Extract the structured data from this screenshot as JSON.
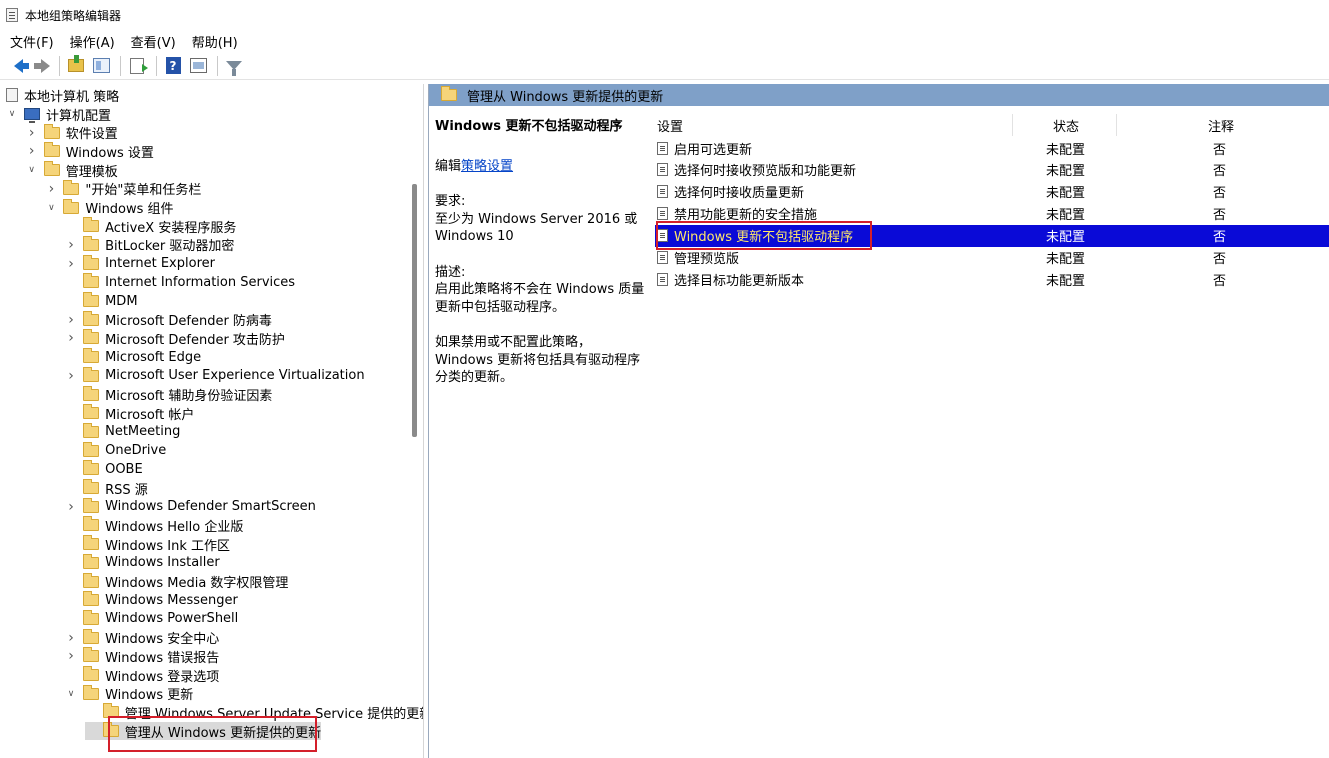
{
  "window": {
    "title": "本地组策略编辑器"
  },
  "menu": [
    "文件(F)",
    "操作(A)",
    "查看(V)",
    "帮助(H)"
  ],
  "toolbar": {
    "icons": [
      "back-arrow-icon",
      "forward-arrow-icon",
      "folder-up-icon",
      "show-hide-tree-icon",
      "export-list-icon",
      "help-icon",
      "properties-icon",
      "filter-icon"
    ],
    "help_glyph": "?"
  },
  "tree": {
    "items": [
      {
        "label": "本地计算机 策略",
        "level": 0,
        "icon": "policy-root-icon",
        "expander": ""
      },
      {
        "label": "计算机配置",
        "level": 0,
        "icon": "computer-icon",
        "expander": "expanded"
      },
      {
        "label": "软件设置",
        "level": 1,
        "icon": "folder-icon",
        "expander": "collapsed"
      },
      {
        "label": "Windows 设置",
        "level": 1,
        "icon": "folder-icon",
        "expander": "collapsed"
      },
      {
        "label": "管理模板",
        "level": 1,
        "icon": "folder-icon",
        "expander": "expanded"
      },
      {
        "label": "\"开始\"菜单和任务栏",
        "level": 2,
        "icon": "folder-icon",
        "expander": "collapsed"
      },
      {
        "label": "Windows 组件",
        "level": 2,
        "icon": "folder-icon",
        "expander": "expanded"
      },
      {
        "label": "ActiveX 安装程序服务",
        "level": 3,
        "icon": "folder-icon",
        "expander": ""
      },
      {
        "label": "BitLocker 驱动器加密",
        "level": 3,
        "icon": "folder-icon",
        "expander": "collapsed"
      },
      {
        "label": "Internet Explorer",
        "level": 3,
        "icon": "folder-icon",
        "expander": "collapsed"
      },
      {
        "label": "Internet Information Services",
        "level": 3,
        "icon": "folder-icon",
        "expander": ""
      },
      {
        "label": "MDM",
        "level": 3,
        "icon": "folder-icon",
        "expander": ""
      },
      {
        "label": "Microsoft Defender 防病毒",
        "level": 3,
        "icon": "folder-icon",
        "expander": "collapsed"
      },
      {
        "label": "Microsoft Defender 攻击防护",
        "level": 3,
        "icon": "folder-icon",
        "expander": "collapsed"
      },
      {
        "label": "Microsoft Edge",
        "level": 3,
        "icon": "folder-icon",
        "expander": ""
      },
      {
        "label": "Microsoft User Experience Virtualization",
        "level": 3,
        "icon": "folder-icon",
        "expander": "collapsed"
      },
      {
        "label": "Microsoft 辅助身份验证因素",
        "level": 3,
        "icon": "folder-icon",
        "expander": ""
      },
      {
        "label": "Microsoft 帐户",
        "level": 3,
        "icon": "folder-icon",
        "expander": ""
      },
      {
        "label": "NetMeeting",
        "level": 3,
        "icon": "folder-icon",
        "expander": ""
      },
      {
        "label": "OneDrive",
        "level": 3,
        "icon": "folder-icon",
        "expander": ""
      },
      {
        "label": "OOBE",
        "level": 3,
        "icon": "folder-icon",
        "expander": ""
      },
      {
        "label": "RSS 源",
        "level": 3,
        "icon": "folder-icon",
        "expander": ""
      },
      {
        "label": "Windows Defender SmartScreen",
        "level": 3,
        "icon": "folder-icon",
        "expander": "collapsed"
      },
      {
        "label": "Windows Hello 企业版",
        "level": 3,
        "icon": "folder-icon",
        "expander": ""
      },
      {
        "label": "Windows Ink 工作区",
        "level": 3,
        "icon": "folder-icon",
        "expander": ""
      },
      {
        "label": "Windows Installer",
        "level": 3,
        "icon": "folder-icon",
        "expander": ""
      },
      {
        "label": "Windows Media 数字权限管理",
        "level": 3,
        "icon": "folder-icon",
        "expander": ""
      },
      {
        "label": "Windows Messenger",
        "level": 3,
        "icon": "folder-icon",
        "expander": ""
      },
      {
        "label": "Windows PowerShell",
        "level": 3,
        "icon": "folder-icon",
        "expander": ""
      },
      {
        "label": "Windows 安全中心",
        "level": 3,
        "icon": "folder-icon",
        "expander": "collapsed"
      },
      {
        "label": "Windows 错误报告",
        "level": 3,
        "icon": "folder-icon",
        "expander": "collapsed"
      },
      {
        "label": "Windows 登录选项",
        "level": 3,
        "icon": "folder-icon",
        "expander": ""
      },
      {
        "label": "Windows 更新",
        "level": 3,
        "icon": "folder-icon",
        "expander": "expanded"
      },
      {
        "label": "管理 Windows Server Update Service 提供的更新",
        "level": 4,
        "icon": "folder-icon",
        "expander": ""
      },
      {
        "label": "管理从 Windows 更新提供的更新",
        "level": 4,
        "icon": "folder-icon",
        "expander": "",
        "selected": true
      }
    ]
  },
  "right": {
    "header": "管理从 Windows 更新提供的更新",
    "description": {
      "title": "Windows 更新不包括驱动程序",
      "edit_prefix": "编辑",
      "edit_link": "策略设置",
      "requirements_label": "要求:",
      "requirements_text": "至少为 Windows Server 2016 或 Windows 10",
      "description_label": "描述:",
      "description_text": "启用此策略将不会在 Windows 质量更新中包括驱动程序。",
      "description_text2": "如果禁用或不配置此策略，Windows 更新将包括具有驱动程序分类的更新。"
    },
    "columns": {
      "setting": "设置",
      "state": "状态",
      "comment": "注释"
    },
    "rows": [
      {
        "setting": "启用可选更新",
        "state": "未配置",
        "comment": "否"
      },
      {
        "setting": "选择何时接收预览版和功能更新",
        "state": "未配置",
        "comment": "否"
      },
      {
        "setting": "选择何时接收质量更新",
        "state": "未配置",
        "comment": "否"
      },
      {
        "setting": "禁用功能更新的安全措施",
        "state": "未配置",
        "comment": "否"
      },
      {
        "setting": "Windows 更新不包括驱动程序",
        "state": "未配置",
        "comment": "否",
        "selected": true
      },
      {
        "setting": "管理预览版",
        "state": "未配置",
        "comment": "否"
      },
      {
        "setting": "选择目标功能更新版本",
        "state": "未配置",
        "comment": "否"
      }
    ]
  },
  "colors": {
    "header_bar": "#7fa0c8",
    "selected_row_bg": "#0a0ad7",
    "selected_row_text": "#ffe86a",
    "highlight_box": "#d41f2a",
    "link": "#0645c8"
  }
}
